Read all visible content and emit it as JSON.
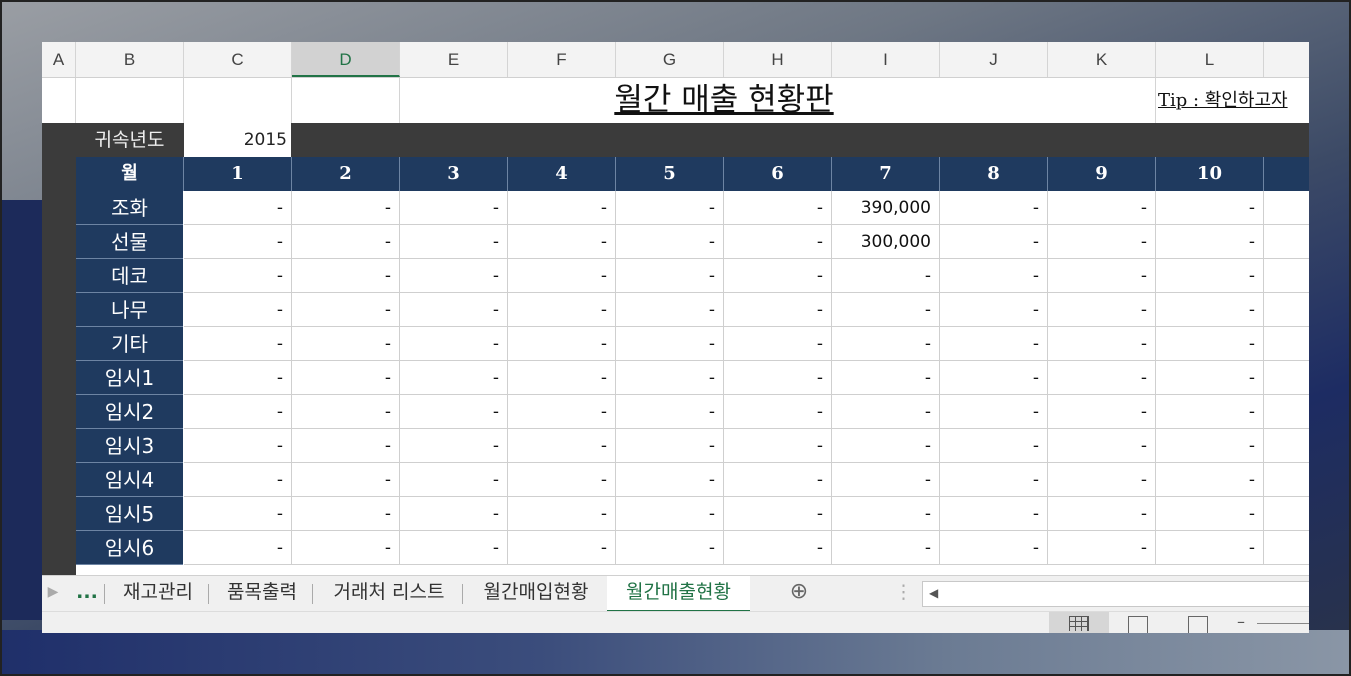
{
  "columns": [
    "A",
    "B",
    "C",
    "D",
    "E",
    "F",
    "G",
    "H",
    "I",
    "J",
    "K",
    "L"
  ],
  "selected_column": "D",
  "title": "월간 매출 현황판",
  "tip": "Tip : 확인하고자",
  "year_label": "귀속년도",
  "year_value": "2015",
  "month_header": "월",
  "months": [
    "1",
    "2",
    "3",
    "4",
    "5",
    "6",
    "7",
    "8",
    "9",
    "10"
  ],
  "rows": [
    {
      "label": "조화",
      "values": [
        "-",
        "-",
        "-",
        "-",
        "-",
        "-",
        "390,000",
        "-",
        "-",
        "-"
      ]
    },
    {
      "label": "선물",
      "values": [
        "-",
        "-",
        "-",
        "-",
        "-",
        "-",
        "300,000",
        "-",
        "-",
        "-"
      ]
    },
    {
      "label": "데코",
      "values": [
        "-",
        "-",
        "-",
        "-",
        "-",
        "-",
        "-",
        "-",
        "-",
        "-"
      ]
    },
    {
      "label": "나무",
      "values": [
        "-",
        "-",
        "-",
        "-",
        "-",
        "-",
        "-",
        "-",
        "-",
        "-"
      ]
    },
    {
      "label": "기타",
      "values": [
        "-",
        "-",
        "-",
        "-",
        "-",
        "-",
        "-",
        "-",
        "-",
        "-"
      ]
    },
    {
      "label": "임시1",
      "values": [
        "-",
        "-",
        "-",
        "-",
        "-",
        "-",
        "-",
        "-",
        "-",
        "-"
      ]
    },
    {
      "label": "임시2",
      "values": [
        "-",
        "-",
        "-",
        "-",
        "-",
        "-",
        "-",
        "-",
        "-",
        "-"
      ]
    },
    {
      "label": "임시3",
      "values": [
        "-",
        "-",
        "-",
        "-",
        "-",
        "-",
        "-",
        "-",
        "-",
        "-"
      ]
    },
    {
      "label": "임시4",
      "values": [
        "-",
        "-",
        "-",
        "-",
        "-",
        "-",
        "-",
        "-",
        "-",
        "-"
      ]
    },
    {
      "label": "임시5",
      "values": [
        "-",
        "-",
        "-",
        "-",
        "-",
        "-",
        "-",
        "-",
        "-",
        "-"
      ]
    },
    {
      "label": "임시6",
      "values": [
        "-",
        "-",
        "-",
        "-",
        "-",
        "-",
        "-",
        "-",
        "-",
        "-"
      ]
    }
  ],
  "tabs": {
    "more": "...",
    "list": [
      "재고관리",
      "품목출력",
      "거래처 리스트",
      "월간매입현황",
      "월간매출현황"
    ],
    "active": "월간매출현황"
  },
  "colors": {
    "header_navy": "#1f3a5f",
    "excel_green": "#217346",
    "dark_band": "#3b3b3b"
  },
  "icons": [
    "scroll-left-icon",
    "add-sheet-icon",
    "normal-view-icon",
    "page-layout-icon",
    "page-break-icon",
    "zoom-out-icon"
  ]
}
